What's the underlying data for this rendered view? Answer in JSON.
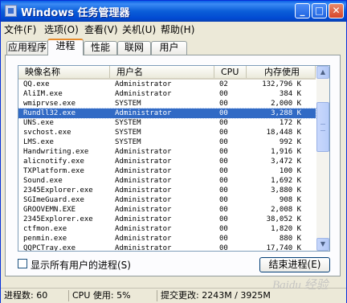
{
  "window": {
    "title": "Windows 任务管理器"
  },
  "menu": [
    "文件(F)",
    "选项(O)",
    "查看(V)",
    "关机(U)",
    "帮助(H)"
  ],
  "tabs": [
    "应用程序",
    "进程",
    "性能",
    "联网",
    "用户"
  ],
  "active_tab": 1,
  "columns": {
    "name": "映像名称",
    "user": "用户名",
    "cpu": "CPU",
    "mem": "内存使用"
  },
  "processes": [
    {
      "name": "QQ.exe",
      "user": "Administrator",
      "cpu": "02",
      "mem": "132,796 K"
    },
    {
      "name": "AliIM.exe",
      "user": "Administrator",
      "cpu": "00",
      "mem": "384 K"
    },
    {
      "name": "wmiprvse.exe",
      "user": "SYSTEM",
      "cpu": "00",
      "mem": "2,000 K"
    },
    {
      "name": "Rundll32.exe",
      "user": "Administrator",
      "cpu": "00",
      "mem": "3,288 K"
    },
    {
      "name": "UNS.exe",
      "user": "SYSTEM",
      "cpu": "00",
      "mem": "172 K"
    },
    {
      "name": "svchost.exe",
      "user": "SYSTEM",
      "cpu": "00",
      "mem": "18,448 K"
    },
    {
      "name": "LMS.exe",
      "user": "SYSTEM",
      "cpu": "00",
      "mem": "992 K"
    },
    {
      "name": "Handwriting.exe",
      "user": "Administrator",
      "cpu": "00",
      "mem": "1,916 K"
    },
    {
      "name": "alicnotify.exe",
      "user": "Administrator",
      "cpu": "00",
      "mem": "3,472 K"
    },
    {
      "name": "TXPlatform.exe",
      "user": "Administrator",
      "cpu": "00",
      "mem": "100 K"
    },
    {
      "name": "Sound.exe",
      "user": "Administrator",
      "cpu": "00",
      "mem": "1,692 K"
    },
    {
      "name": "2345Explorer.exe",
      "user": "Administrator",
      "cpu": "00",
      "mem": "3,880 K"
    },
    {
      "name": "SGImeGuard.exe",
      "user": "Administrator",
      "cpu": "00",
      "mem": "908 K"
    },
    {
      "name": "GROOVEMN.EXE",
      "user": "Administrator",
      "cpu": "00",
      "mem": "2,008 K"
    },
    {
      "name": "2345Explorer.exe",
      "user": "Administrator",
      "cpu": "00",
      "mem": "38,052 K"
    },
    {
      "name": "ctfmon.exe",
      "user": "Administrator",
      "cpu": "00",
      "mem": "1,820 K"
    },
    {
      "name": "penmin.exe",
      "user": "Administrator",
      "cpu": "00",
      "mem": "880 K"
    },
    {
      "name": "QQPCTray.exe",
      "user": "Administrator",
      "cpu": "00",
      "mem": "17,740 K"
    }
  ],
  "selected_process": "Rundll32.exe",
  "show_all_users_label": "显示所有用户的进程(S)",
  "end_process_label": "结束进程(E)",
  "status": {
    "processes": "进程数: 60",
    "cpu": "CPU 使用: 5%",
    "commit": "提交更改: 2243M / 3925M"
  },
  "watermark": "Baidu 经验",
  "colors": {
    "title_bar": "#0b5ed8",
    "selection": "#316ac5",
    "window_bg": "#ece9d8",
    "active_tab_accent": "#e68b2c"
  }
}
